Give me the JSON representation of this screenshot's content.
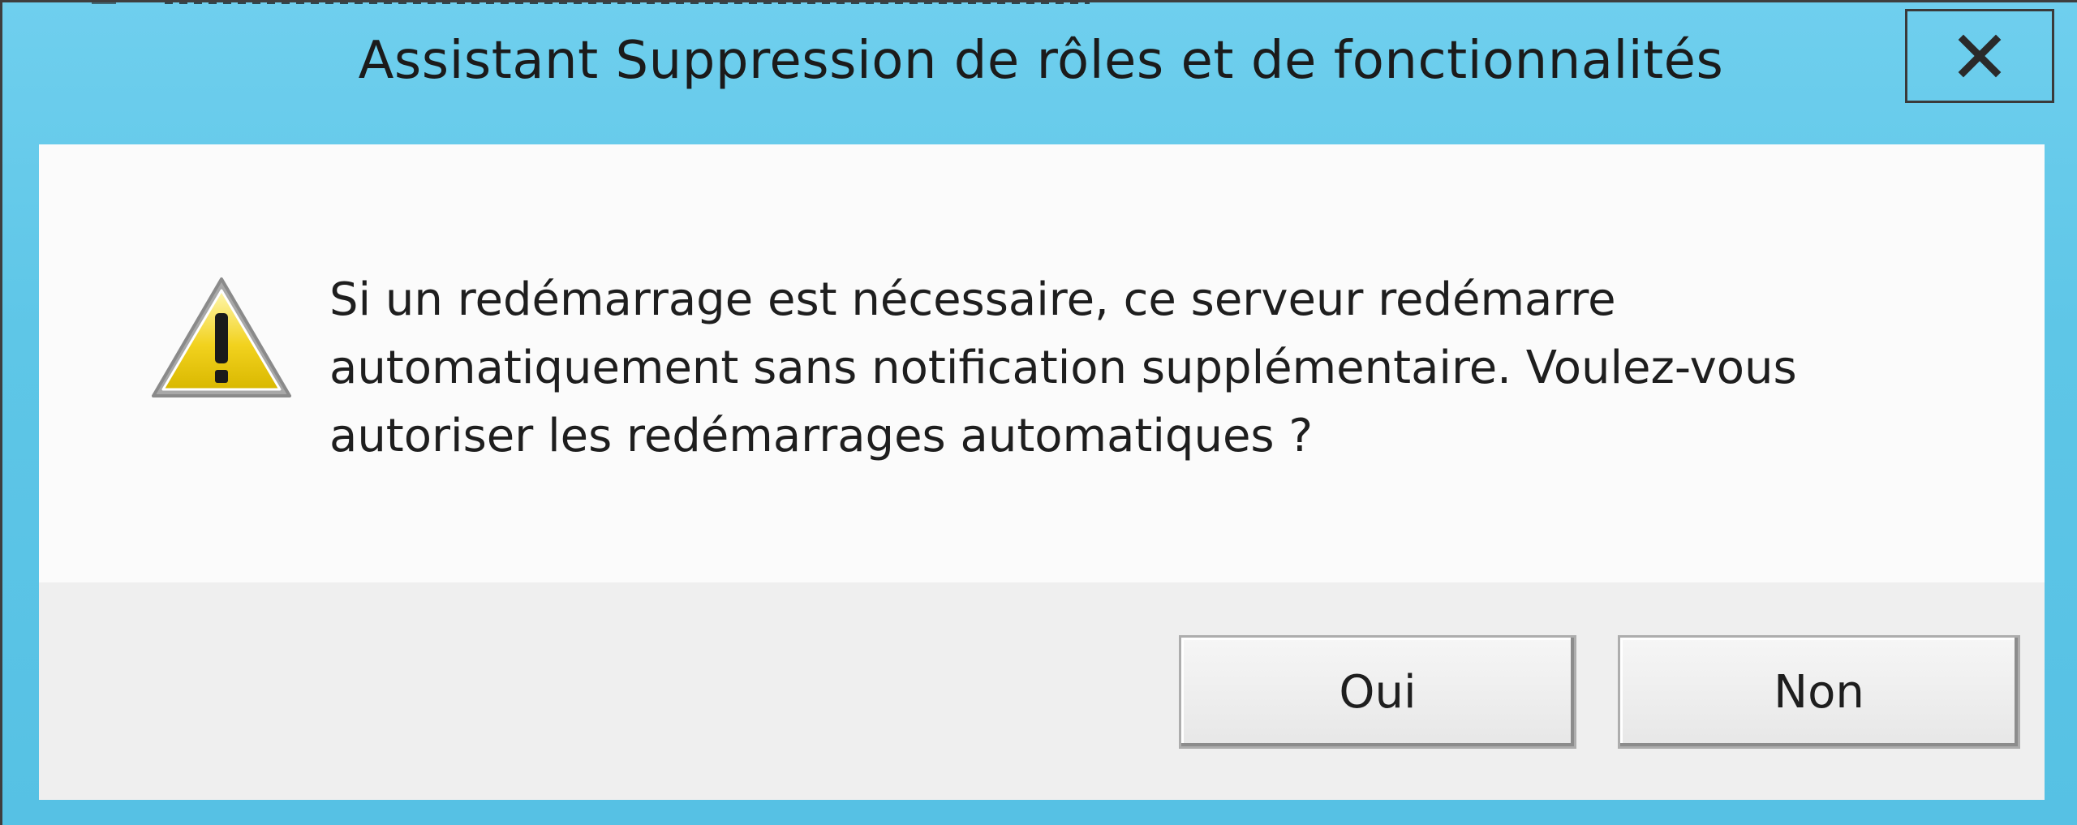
{
  "window": {
    "title": "Assistant Suppression de rôles et de fonctionnalités",
    "close_label": "✕"
  },
  "dialog": {
    "icon": "warning-icon",
    "message": "Si un redémarrage est nécessaire, ce serveur redémarre automatiquement sans notification supplémentaire. Voulez-vous autoriser les redémarrages automatiques ?"
  },
  "buttons": {
    "yes_label": "Oui",
    "no_label": "Non"
  },
  "colors": {
    "frame": "#5ec6e7",
    "content_bg": "#fbfbfb",
    "footer_bg": "#efefef",
    "warning_yellow": "#f2d21e"
  }
}
